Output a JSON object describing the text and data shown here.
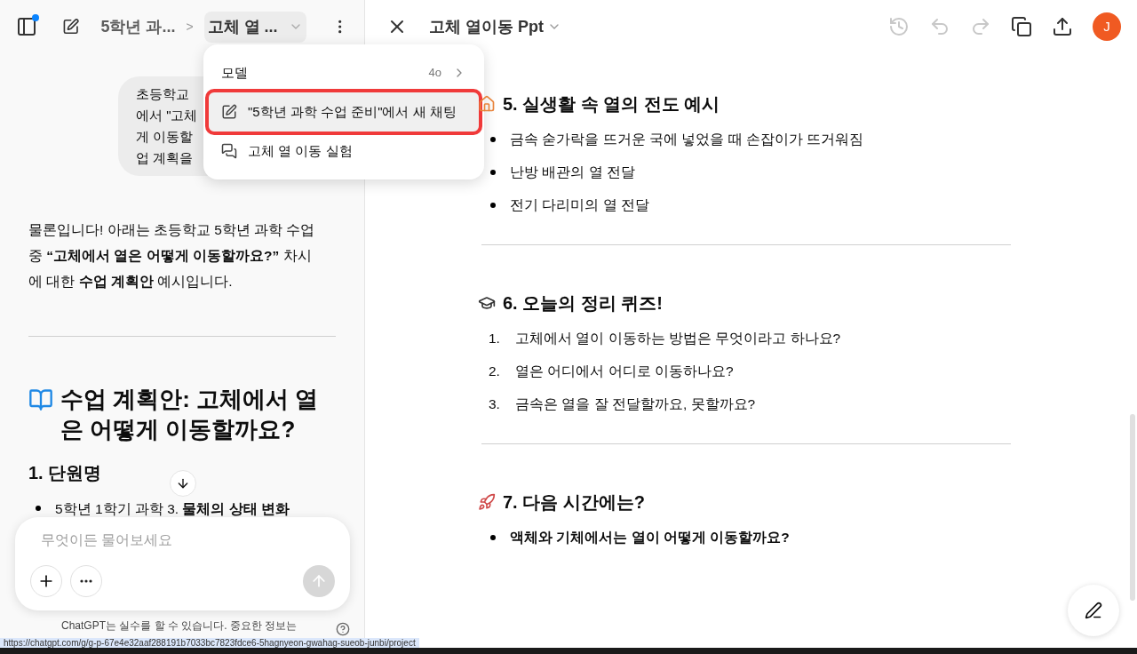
{
  "chat_header": {
    "project": "5학년 과...",
    "separator": ">",
    "chat_title": "고체 열 ...",
    "has_notification": true
  },
  "dropdown": {
    "items": [
      {
        "kind": "model",
        "label": "모델",
        "value": "4o",
        "highlighted": false
      },
      {
        "kind": "new_chat",
        "label": "\"5학년 과학 수업 준비\"에서 새 채팅",
        "highlighted": true
      },
      {
        "kind": "thread",
        "label": "고체 열 이동 실험",
        "highlighted": false
      }
    ]
  },
  "user_message": {
    "lines": [
      "초등학교",
      "에서 \"고체",
      "게 이동할",
      "업 계획을"
    ]
  },
  "assistant": {
    "intro": "물론입니다! 아래는 초등학교 5학년 과학 수업 중 **“고체에서 열은 어떻게 이동할까요?”** 차시에 대한 **수업 계획안** 예시입니다.",
    "plan_title": "수업 계획안: 고체에서 열은 어떻게 이동할까요?",
    "section_title": "1. 단원명",
    "bullets": [
      "5학년 1학기 과학 3. **물체의 상태 변화**"
    ]
  },
  "composer": {
    "placeholder": "무엇이든 물어보세요"
  },
  "disclaimer": "ChatGPT는 실수를 할 수 있습니다. 중요한 정보는",
  "canvas": {
    "title": "고체 열이동 Ppt",
    "avatar": "J",
    "sections": [
      {
        "kind": "bullet",
        "title": "5. 실생활 속 열의 전도 예시",
        "items": [
          {
            "text": "금속 숟가락을 뜨거운 국에 넣었을 때 손잡이가 뜨거워짐"
          },
          {
            "text": "난방 배관의 열 전달"
          },
          {
            "text": "전기 다리미의 열 전달"
          }
        ]
      },
      {
        "kind": "numbered",
        "title": "6. 오늘의 정리 퀴즈!",
        "items": [
          {
            "number": "1.",
            "text": "고체에서 열이 이동하는 방법은 무엇이라고 하나요?"
          },
          {
            "number": "2.",
            "text": "열은 어디에서 어디로 이동하나요?"
          },
          {
            "number": "3.",
            "text": "금속은 열을 잘 전달할까요, 못할까요?"
          }
        ]
      },
      {
        "kind": "bold",
        "title": "7. 다음 시간에는?",
        "items": [
          {
            "text": "액체와 기체에서는 열이 어떻게 이동할까요?"
          }
        ]
      }
    ]
  },
  "status_url": "https://chatgpt.com/g/g-p-67e4e32aaf288191b7033bc7823fdce6-5hagnyeon-gwahag-sueob-junbi/project"
}
